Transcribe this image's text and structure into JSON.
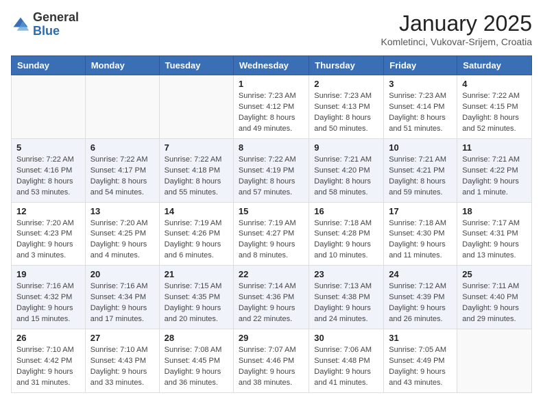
{
  "header": {
    "logo": {
      "general": "General",
      "blue": "Blue"
    },
    "title": "January 2025",
    "location": "Komletinci, Vukovar-Srijem, Croatia"
  },
  "weekdays": [
    "Sunday",
    "Monday",
    "Tuesday",
    "Wednesday",
    "Thursday",
    "Friday",
    "Saturday"
  ],
  "weeks": [
    [
      {
        "day": "",
        "info": ""
      },
      {
        "day": "",
        "info": ""
      },
      {
        "day": "",
        "info": ""
      },
      {
        "day": "1",
        "info": "Sunrise: 7:23 AM\nSunset: 4:12 PM\nDaylight: 8 hours and 49 minutes."
      },
      {
        "day": "2",
        "info": "Sunrise: 7:23 AM\nSunset: 4:13 PM\nDaylight: 8 hours and 50 minutes."
      },
      {
        "day": "3",
        "info": "Sunrise: 7:23 AM\nSunset: 4:14 PM\nDaylight: 8 hours and 51 minutes."
      },
      {
        "day": "4",
        "info": "Sunrise: 7:22 AM\nSunset: 4:15 PM\nDaylight: 8 hours and 52 minutes."
      }
    ],
    [
      {
        "day": "5",
        "info": "Sunrise: 7:22 AM\nSunset: 4:16 PM\nDaylight: 8 hours and 53 minutes."
      },
      {
        "day": "6",
        "info": "Sunrise: 7:22 AM\nSunset: 4:17 PM\nDaylight: 8 hours and 54 minutes."
      },
      {
        "day": "7",
        "info": "Sunrise: 7:22 AM\nSunset: 4:18 PM\nDaylight: 8 hours and 55 minutes."
      },
      {
        "day": "8",
        "info": "Sunrise: 7:22 AM\nSunset: 4:19 PM\nDaylight: 8 hours and 57 minutes."
      },
      {
        "day": "9",
        "info": "Sunrise: 7:21 AM\nSunset: 4:20 PM\nDaylight: 8 hours and 58 minutes."
      },
      {
        "day": "10",
        "info": "Sunrise: 7:21 AM\nSunset: 4:21 PM\nDaylight: 8 hours and 59 minutes."
      },
      {
        "day": "11",
        "info": "Sunrise: 7:21 AM\nSunset: 4:22 PM\nDaylight: 9 hours and 1 minute."
      }
    ],
    [
      {
        "day": "12",
        "info": "Sunrise: 7:20 AM\nSunset: 4:23 PM\nDaylight: 9 hours and 3 minutes."
      },
      {
        "day": "13",
        "info": "Sunrise: 7:20 AM\nSunset: 4:25 PM\nDaylight: 9 hours and 4 minutes."
      },
      {
        "day": "14",
        "info": "Sunrise: 7:19 AM\nSunset: 4:26 PM\nDaylight: 9 hours and 6 minutes."
      },
      {
        "day": "15",
        "info": "Sunrise: 7:19 AM\nSunset: 4:27 PM\nDaylight: 9 hours and 8 minutes."
      },
      {
        "day": "16",
        "info": "Sunrise: 7:18 AM\nSunset: 4:28 PM\nDaylight: 9 hours and 10 minutes."
      },
      {
        "day": "17",
        "info": "Sunrise: 7:18 AM\nSunset: 4:30 PM\nDaylight: 9 hours and 11 minutes."
      },
      {
        "day": "18",
        "info": "Sunrise: 7:17 AM\nSunset: 4:31 PM\nDaylight: 9 hours and 13 minutes."
      }
    ],
    [
      {
        "day": "19",
        "info": "Sunrise: 7:16 AM\nSunset: 4:32 PM\nDaylight: 9 hours and 15 minutes."
      },
      {
        "day": "20",
        "info": "Sunrise: 7:16 AM\nSunset: 4:34 PM\nDaylight: 9 hours and 17 minutes."
      },
      {
        "day": "21",
        "info": "Sunrise: 7:15 AM\nSunset: 4:35 PM\nDaylight: 9 hours and 20 minutes."
      },
      {
        "day": "22",
        "info": "Sunrise: 7:14 AM\nSunset: 4:36 PM\nDaylight: 9 hours and 22 minutes."
      },
      {
        "day": "23",
        "info": "Sunrise: 7:13 AM\nSunset: 4:38 PM\nDaylight: 9 hours and 24 minutes."
      },
      {
        "day": "24",
        "info": "Sunrise: 7:12 AM\nSunset: 4:39 PM\nDaylight: 9 hours and 26 minutes."
      },
      {
        "day": "25",
        "info": "Sunrise: 7:11 AM\nSunset: 4:40 PM\nDaylight: 9 hours and 29 minutes."
      }
    ],
    [
      {
        "day": "26",
        "info": "Sunrise: 7:10 AM\nSunset: 4:42 PM\nDaylight: 9 hours and 31 minutes."
      },
      {
        "day": "27",
        "info": "Sunrise: 7:10 AM\nSunset: 4:43 PM\nDaylight: 9 hours and 33 minutes."
      },
      {
        "day": "28",
        "info": "Sunrise: 7:08 AM\nSunset: 4:45 PM\nDaylight: 9 hours and 36 minutes."
      },
      {
        "day": "29",
        "info": "Sunrise: 7:07 AM\nSunset: 4:46 PM\nDaylight: 9 hours and 38 minutes."
      },
      {
        "day": "30",
        "info": "Sunrise: 7:06 AM\nSunset: 4:48 PM\nDaylight: 9 hours and 41 minutes."
      },
      {
        "day": "31",
        "info": "Sunrise: 7:05 AM\nSunset: 4:49 PM\nDaylight: 9 hours and 43 minutes."
      },
      {
        "day": "",
        "info": ""
      }
    ]
  ]
}
